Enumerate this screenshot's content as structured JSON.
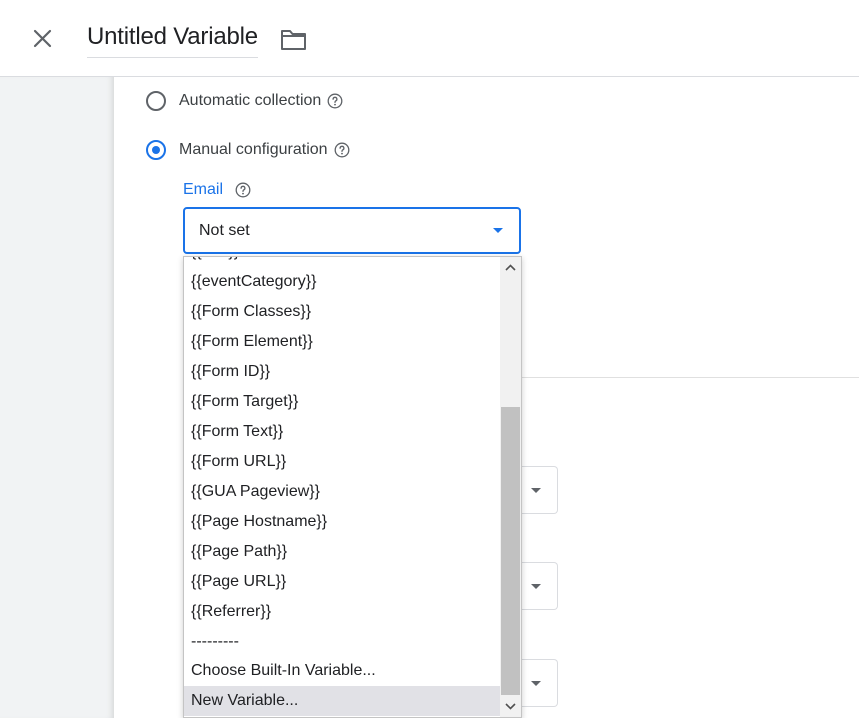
{
  "header": {
    "title": "Untitled Variable",
    "close_icon": "close-icon",
    "folder_icon": "folder-icon"
  },
  "collection": {
    "automatic_label": "Automatic collection",
    "manual_label": "Manual configuration",
    "selected": "manual"
  },
  "email_field": {
    "label": "Email",
    "value": "Not set"
  },
  "dropdown": {
    "partial_top_option": "{{......}}",
    "options": [
      "{{eventCategory}}",
      "{{Form Classes}}",
      "{{Form Element}}",
      "{{Form ID}}",
      "{{Form Target}}",
      "{{Form Text}}",
      "{{Form URL}}",
      "{{GUA Pageview}}",
      "{{Page Hostname}}",
      "{{Page Path}}",
      "{{Page URL}}",
      "{{Referrer}}",
      "---------",
      "Choose Built-In Variable...",
      "New Variable..."
    ],
    "highlighted": "New Variable..."
  },
  "colors": {
    "accent": "#1a73e8",
    "highlight": "#e1e1e6",
    "sidebar": "#f1f3f4"
  }
}
